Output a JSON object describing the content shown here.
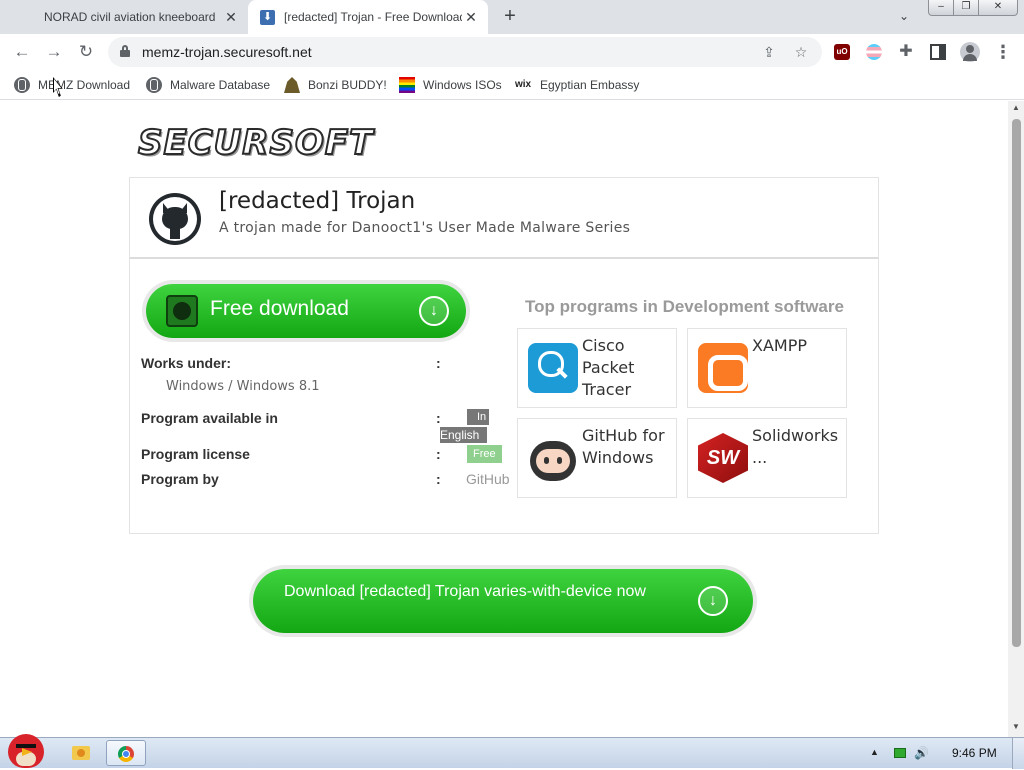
{
  "browser": {
    "tabs": [
      {
        "title": "NORAD civil aviation kneeboard"
      },
      {
        "title": "[redacted] Trojan - Free Download"
      }
    ],
    "window_controls": {
      "minimize": "–",
      "maximize": "❐",
      "close": "✕"
    },
    "url": "memz-trojan.securesoft.net",
    "bookmarks": [
      {
        "label": "MEMZ Download",
        "icon": "globe-icon"
      },
      {
        "label": "Malware Database",
        "icon": "globe-icon"
      },
      {
        "label": "Bonzi BUDDY!",
        "icon": "bonzi-icon"
      },
      {
        "label": "Windows ISOs",
        "icon": "rainbow-flag-icon"
      },
      {
        "label": "Egyptian Embassy",
        "icon": "wix-icon"
      }
    ],
    "ublock_label": "uO"
  },
  "page": {
    "logo": "SECURSOFT",
    "title": "[redacted] Trojan",
    "subtitle": "A trojan made for Danooct1's User Made Malware Series",
    "download_button": "Free download",
    "info": {
      "works_under_label": "Works under:",
      "works_under_value": "Windows / Windows 8.1",
      "available_label": "Program available in",
      "available_value_1": "In",
      "available_value_2": "English",
      "license_label": "Program license",
      "license_value": "Free",
      "by_label": "Program by",
      "by_value": "GitHub",
      "colon": ":"
    },
    "top_programs": {
      "heading": "Top programs in Development software",
      "items": [
        {
          "name": "Cisco Packet Tracer",
          "icon": "cisco-packet-tracer-icon"
        },
        {
          "name": "XAMPP",
          "icon": "xampp-icon"
        },
        {
          "name": "GitHub for Windows",
          "icon": "github-octocat-icon"
        },
        {
          "name": "Solidworks ...",
          "icon": "solidworks-icon"
        }
      ]
    },
    "bottom_download": "Download [redacted] Trojan varies-with-device now",
    "solidworks_letters": "SW"
  },
  "taskbar": {
    "clock": "9:46 PM"
  },
  "colors": {
    "button_green": "#22b522",
    "tab_strip": "#dee1e6",
    "taskbar": "#c4d3e7"
  }
}
